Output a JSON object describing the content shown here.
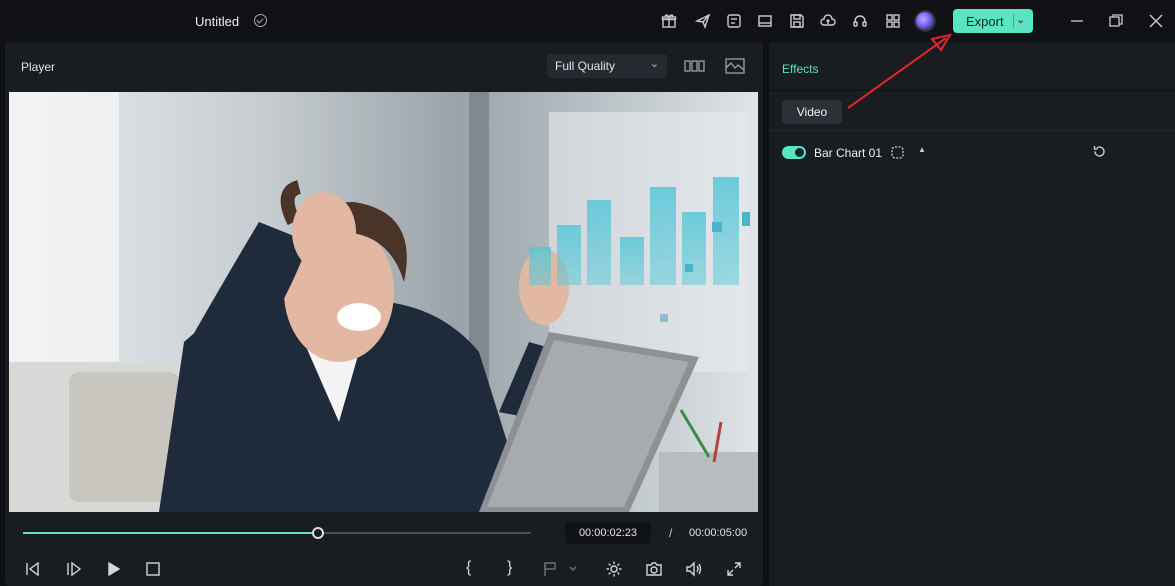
{
  "app": {
    "title": "Untitled"
  },
  "toolbar": {
    "icons": [
      "gift-icon",
      "send-icon",
      "checklist-icon",
      "layout-icon",
      "save-icon",
      "cloud-upload-icon",
      "headset-icon",
      "apps-grid-icon"
    ],
    "export_label": "Export"
  },
  "player": {
    "title": "Player",
    "quality": "Full Quality",
    "current_time": "00:00:02:23",
    "separator": "/",
    "total_time": "00:00:05:00",
    "progress": 0.58,
    "mark_in": "{",
    "mark_out": "}"
  },
  "effects": {
    "tab": "Effects",
    "category": "Video",
    "item_name": "Bar Chart 01",
    "item_enabled": true
  },
  "colors": {
    "accent": "#5ae4c2",
    "panel": "#191c20",
    "background": "#0f1114",
    "annotation": "#e0262b"
  }
}
